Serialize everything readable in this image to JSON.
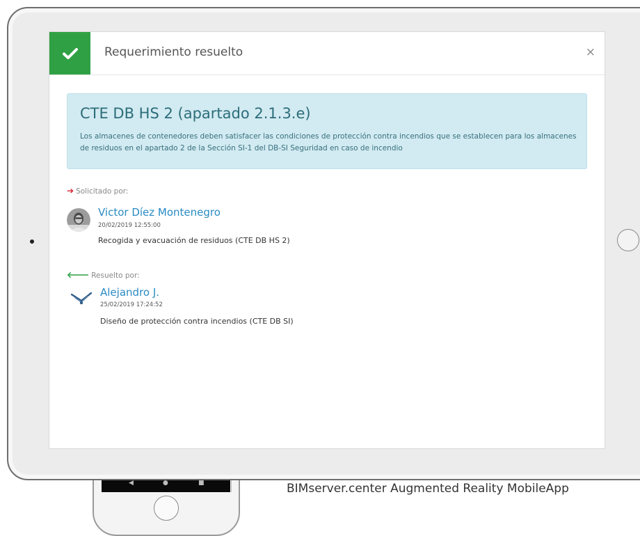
{
  "modal": {
    "title": "Requerimiento resuelto",
    "close_symbol": "×",
    "status_icon": "check-icon"
  },
  "requirement": {
    "code": "CTE DB HS 2 (apartado 2.1.3.e)",
    "description": "Los almacenes de contenedores deben satisfacer las condiciones de protección contra incendios que se establecen para los almacenes de residuos en el apartado 2 de la Sección SI-1 del DB-SI Seguridad en caso de incendio"
  },
  "requested": {
    "label": "Solicitado por:",
    "name": "Victor Díez Montenegro",
    "datetime": "20/02/2019 12:55:00",
    "discipline": "Recogida y evacuación de residuos (CTE DB HS 2)"
  },
  "resolved": {
    "label": "Resuelto por:",
    "name": "Alejandro J.",
    "datetime": "25/02/2019 17:24:52",
    "discipline": "Diseño de protección contra incendios (CTE DB SI)"
  },
  "caption": "BIMserver.center Augmented Reality MobileApp",
  "colors": {
    "success": "#2fa144",
    "alert_bg": "#d2eaf1",
    "link": "#2a8bc4",
    "arrow_in": "#d9232d",
    "arrow_out": "#2fa144"
  }
}
